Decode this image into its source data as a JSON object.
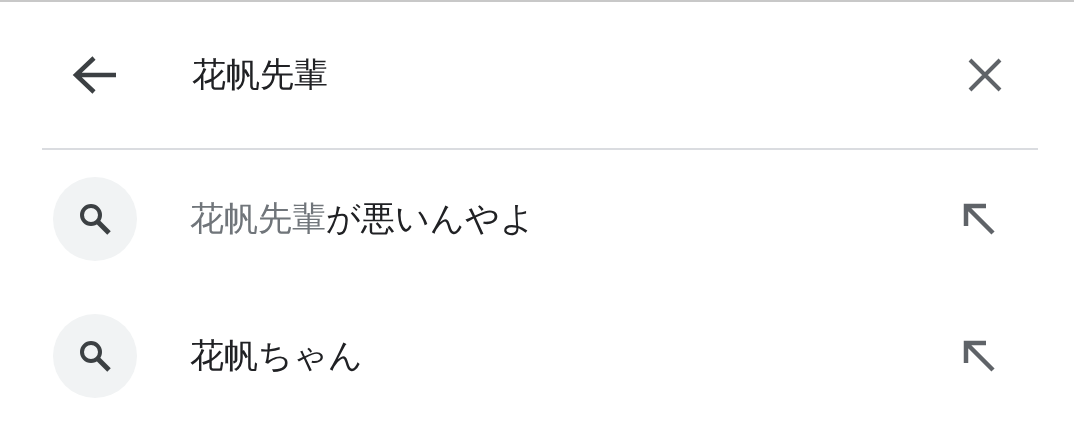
{
  "search": {
    "value": "花帆先輩"
  },
  "suggestions": [
    {
      "matched": "花帆先輩",
      "rest": "が悪いんやよ"
    },
    {
      "rest": "花帆ちゃん"
    }
  ]
}
